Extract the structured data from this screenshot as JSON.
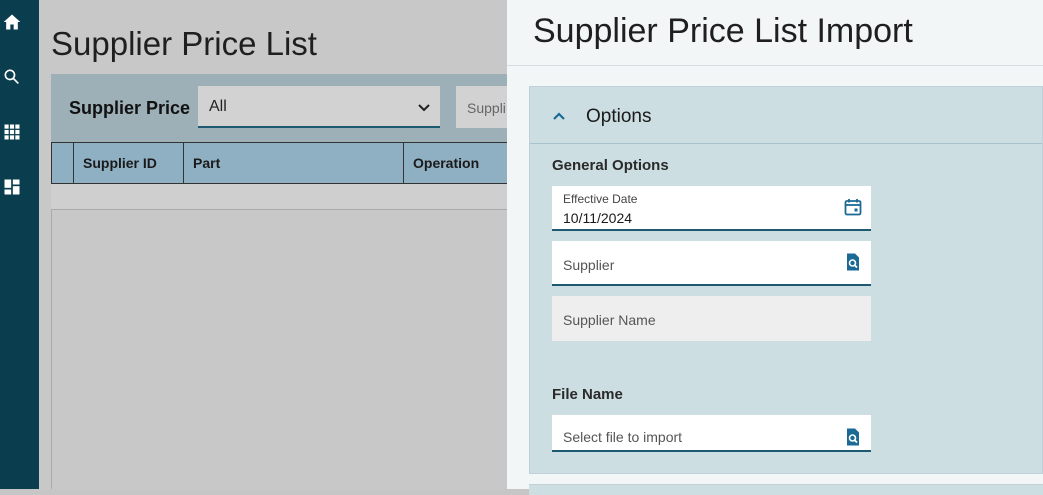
{
  "nav": {
    "items": [
      {
        "icon": "home-icon"
      },
      {
        "icon": "search-icon"
      },
      {
        "icon": "apps-grid-icon"
      },
      {
        "icon": "dashboard-icon"
      }
    ]
  },
  "background_page": {
    "title": "Supplier Price List",
    "filter": {
      "label": "Supplier Price",
      "select_value": "All",
      "second_input_placeholder": "Suppli"
    },
    "grid": {
      "columns": [
        "Supplier ID",
        "Part",
        "Operation"
      ]
    }
  },
  "panel": {
    "title": "Supplier Price List Import",
    "section": {
      "title": "Options",
      "general_options_label": "General Options",
      "effective_date": {
        "label": "Effective Date",
        "value": "10/11/2024"
      },
      "supplier": {
        "placeholder": "Supplier"
      },
      "supplier_name": {
        "placeholder": "Supplier Name"
      },
      "file_name_label": "File Name",
      "file_input": {
        "placeholder": "Select file to import"
      }
    }
  },
  "colors": {
    "nav_bg": "#0a3d4e",
    "accent": "#1d5a72",
    "section_bg": "#cddee3",
    "icon_blue": "#1b6a96"
  }
}
